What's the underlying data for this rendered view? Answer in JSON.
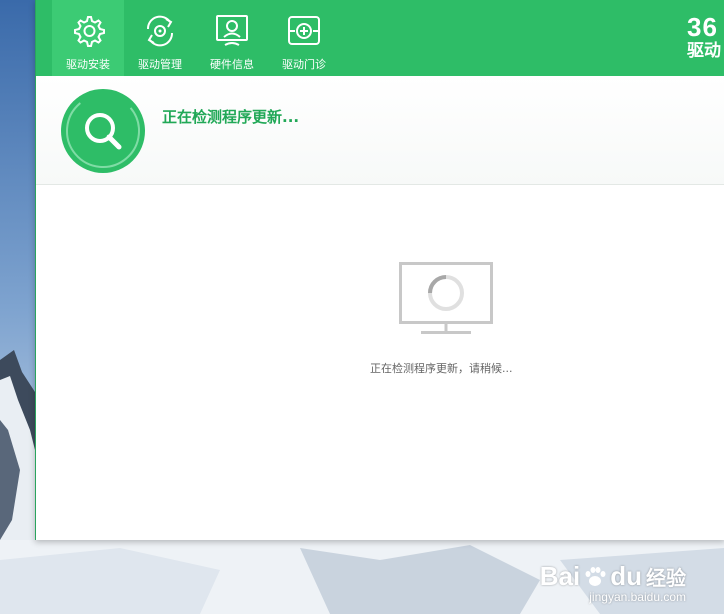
{
  "colors": {
    "brand_green": "#2ebd67",
    "active_tab": "#3ccb74",
    "status_text": "#21a857",
    "loading_text": "#666666",
    "monitor_gray": "#c8c8c8"
  },
  "toolbar": {
    "items": [
      {
        "label": "驱动安装",
        "icon": "gear-icon",
        "active": true
      },
      {
        "label": "驱动管理",
        "icon": "refresh-disc-icon",
        "active": false
      },
      {
        "label": "硬件信息",
        "icon": "monitor-user-icon",
        "active": false
      },
      {
        "label": "驱动门诊",
        "icon": "first-aid-icon",
        "active": false
      }
    ],
    "logo_number": "36",
    "logo_text": "驱动"
  },
  "status": {
    "title": "正在检测程序更新...",
    "icon": "search-icon"
  },
  "content": {
    "icon": "monitor-loading-icon",
    "loading_text": "正在检测程序更新，请稍候..."
  },
  "watermark": {
    "main_prefix": "Bai",
    "main_suffix": "du",
    "cn": "经验",
    "sub": "jingyan.baidu.com"
  }
}
